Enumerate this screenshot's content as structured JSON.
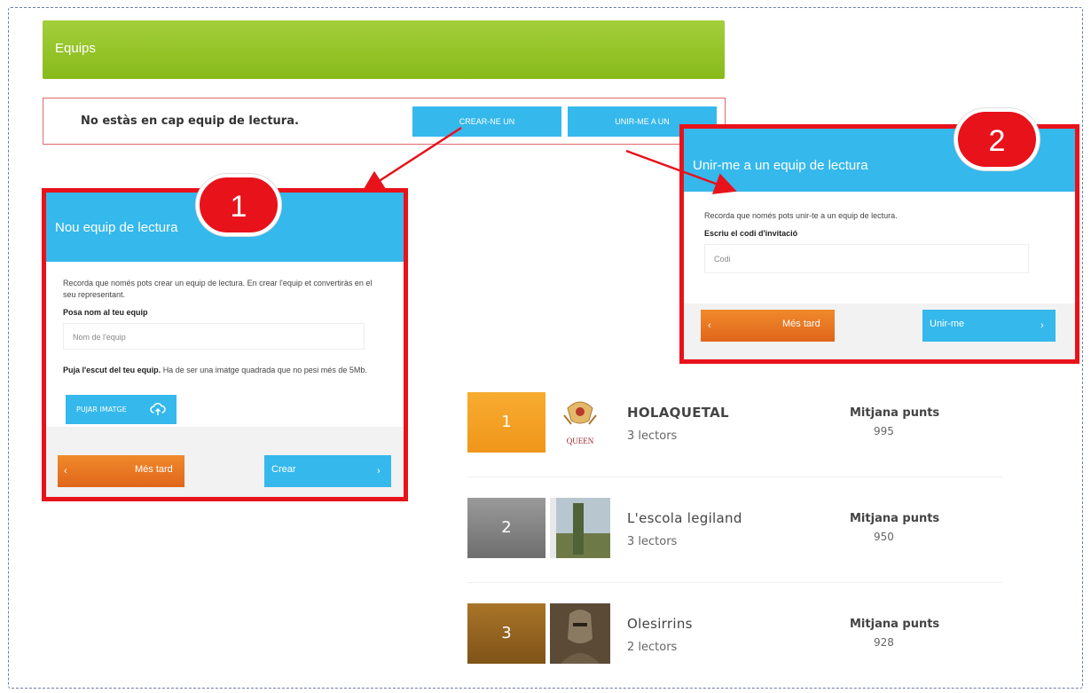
{
  "header": {
    "title": "Equips"
  },
  "status": {
    "message": "No estàs en cap equip de lectura.",
    "create_label": "CREAR-NE UN",
    "join_label": "UNIR-ME A UN"
  },
  "panel_create": {
    "badge": "1",
    "title": "Nou equip de lectura",
    "hint": "Recorda que només pots crear un equip de lectura. En crear l'equip et convertiràs en el seu representant.",
    "name_label": "Posa nom al teu equip",
    "name_placeholder": "Nom de l'equip",
    "upload_bold": "Puja l'escut del teu equip.",
    "upload_text": "Ha de ser una imatge quadrada que no pesi més de 5Mb.",
    "upload_button": "PUJAR IMATGE",
    "later_button": "Més tard",
    "create_button": "Crear"
  },
  "panel_join": {
    "badge": "2",
    "title": "Unir-me a un equip de lectura",
    "hint": "Recorda que només pots unir-te a un equip de lectura.",
    "code_label": "Escriu el codi d'invitació",
    "code_placeholder": "Codi",
    "later_button": "Més tard",
    "join_button": "Unir-me"
  },
  "ranking": [
    {
      "rank": "1",
      "name": "HOLAQUETAL",
      "readers": "3 lectors",
      "avg_label": "Mitjana punts",
      "avg": "995",
      "rank_color": "#f5a623",
      "logo_text": "QUEEN"
    },
    {
      "rank": "2",
      "name": "L'escola legiland",
      "readers": "3 lectors",
      "avg_label": "Mitjana punts",
      "avg": "950",
      "rank_color": "#8a8a8a"
    },
    {
      "rank": "3",
      "name": "Olesirrins",
      "readers": "2 lectors",
      "avg_label": "Mitjana punts",
      "avg": "928",
      "rank_color": "#9a6a20"
    }
  ],
  "icons": {
    "chevron_left": "‹",
    "chevron_right": "›"
  },
  "colors": {
    "accent_blue": "#35b8ec",
    "header_green": "#94c524",
    "highlight_red": "#e8121b",
    "button_orange": "#e8741f"
  }
}
